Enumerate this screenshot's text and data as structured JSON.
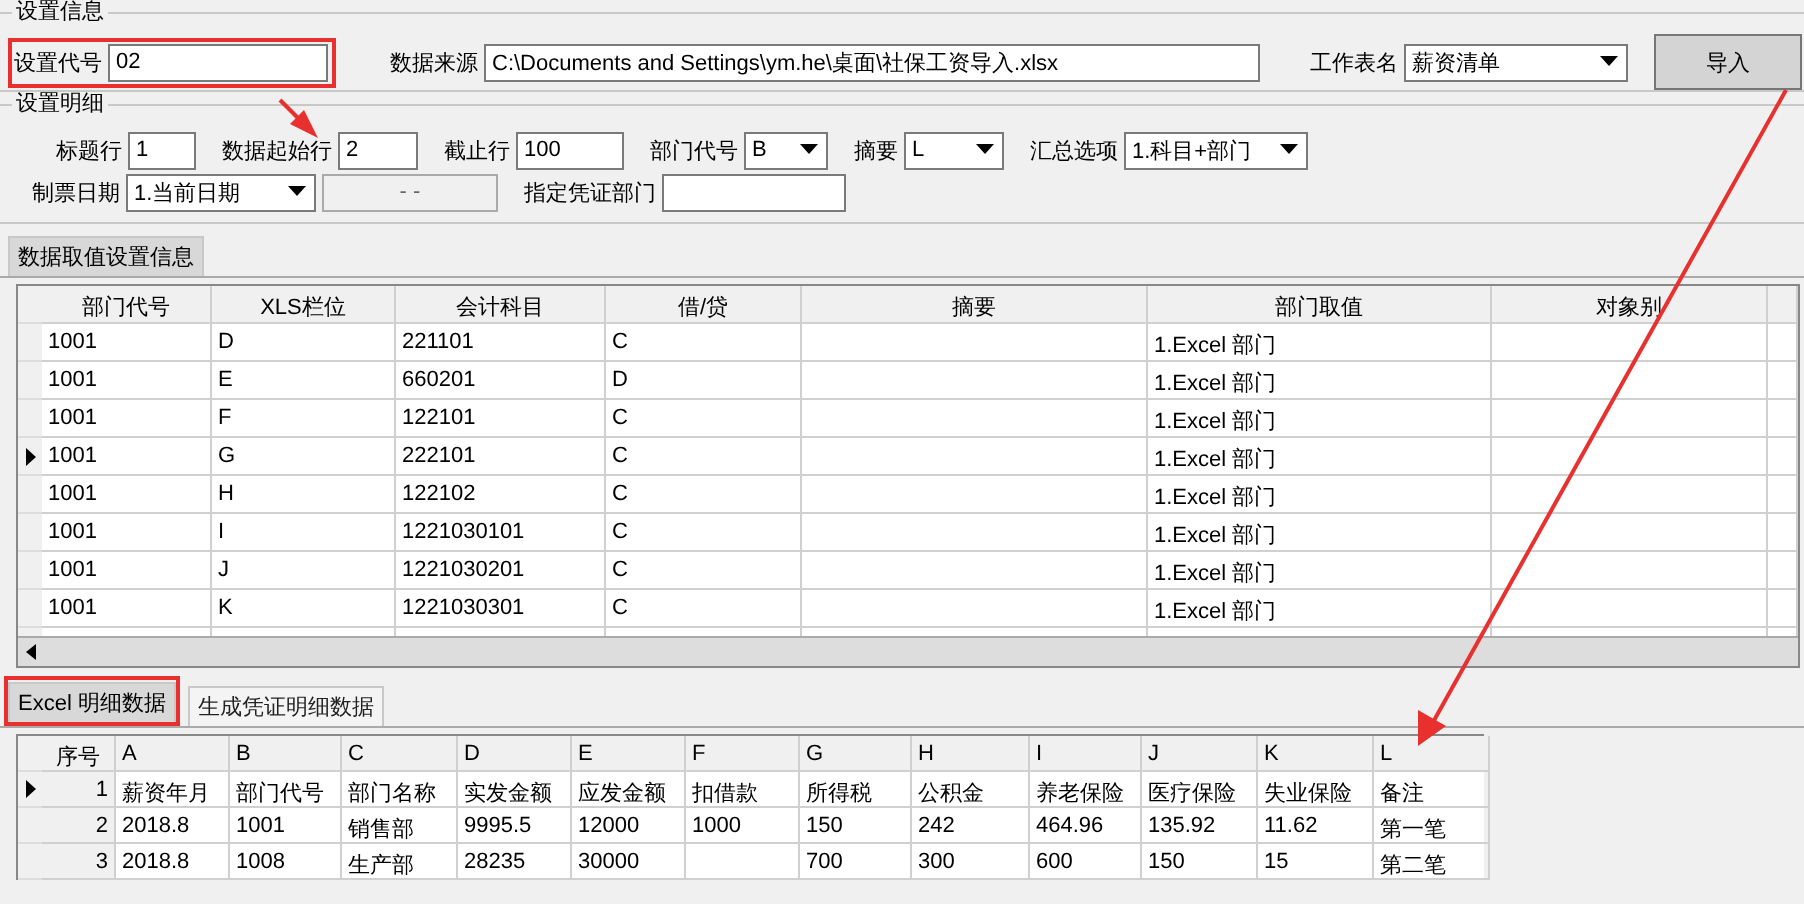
{
  "settings": {
    "title": "设置信息",
    "code_label": "设置代号",
    "code_value": "02",
    "source_label": "数据来源",
    "source_value": "C:\\Documents and Settings\\ym.he\\桌面\\社保工资导入.xlsx",
    "sheet_label": "工作表名",
    "sheet_value": "薪资清单",
    "import_button": "导入"
  },
  "detail": {
    "title": "设置明细",
    "fields": [
      {
        "kind": "input",
        "label": "标题行",
        "value": "1"
      },
      {
        "kind": "input",
        "label": "数据起始行",
        "value": "2"
      },
      {
        "kind": "input",
        "label": "截止行",
        "value": "100"
      },
      {
        "kind": "select",
        "label": "部门代号",
        "value": "B"
      },
      {
        "kind": "select",
        "label": "摘要",
        "value": "L"
      },
      {
        "kind": "select",
        "label": "汇总选项",
        "value": "1.科目+部门"
      }
    ],
    "row2": [
      {
        "kind": "select",
        "label": "制票日期",
        "value": "1.当前日期"
      },
      {
        "kind": "date",
        "placeholder": "- -"
      },
      {
        "kind": "input",
        "label": "指定凭证部门"
      }
    ]
  },
  "grid_tab": {
    "label": "数据取值设置信息",
    "selected": true
  },
  "grid": {
    "columns": [
      "部门代号",
      "XLS栏位",
      "会计科目",
      "借/贷",
      "摘要",
      "部门取值",
      "对象别"
    ],
    "rows": [
      {
        "selected": false,
        "cells": [
          "1001",
          "D",
          "221101",
          "C",
          "",
          "1.Excel 部门",
          ""
        ]
      },
      {
        "selected": false,
        "cells": [
          "1001",
          "E",
          "660201",
          "D",
          "",
          "1.Excel 部门",
          ""
        ]
      },
      {
        "selected": false,
        "cells": [
          "1001",
          "F",
          "122101",
          "C",
          "",
          "1.Excel 部门",
          ""
        ]
      },
      {
        "selected": true,
        "cells": [
          "1001",
          "G",
          "222101",
          "C",
          "",
          "1.Excel 部门",
          ""
        ]
      },
      {
        "selected": false,
        "cells": [
          "1001",
          "H",
          "122102",
          "C",
          "",
          "1.Excel 部门",
          ""
        ]
      },
      {
        "selected": false,
        "cells": [
          "1001",
          "I",
          "1221030101",
          "C",
          "",
          "1.Excel 部门",
          ""
        ]
      },
      {
        "selected": false,
        "cells": [
          "1001",
          "J",
          "1221030201",
          "C",
          "",
          "1.Excel 部门",
          ""
        ]
      },
      {
        "selected": false,
        "cells": [
          "1001",
          "K",
          "1221030301",
          "C",
          "",
          "1.Excel 部门",
          ""
        ]
      }
    ]
  },
  "bottom_tabs": [
    {
      "label": "Excel 明细数据",
      "selected": true
    },
    {
      "label": "生成凭证明细数据",
      "selected": false
    }
  ],
  "excel": {
    "columns": [
      "序号",
      "A",
      "B",
      "C",
      "D",
      "E",
      "F",
      "G",
      "H",
      "I",
      "J",
      "K",
      "L"
    ],
    "rows": [
      {
        "selected": true,
        "cells": [
          "1",
          "薪资年月",
          "部门代号",
          "部门名称",
          "实发金额",
          "应发金额",
          "扣借款",
          "所得税",
          "公积金",
          "养老保险",
          "医疗保险",
          "失业保险",
          "备注"
        ]
      },
      {
        "selected": false,
        "cells": [
          "2",
          "2018.8",
          "1001",
          "销售部",
          "9995.5",
          "12000",
          "1000",
          "150",
          "242",
          "464.96",
          "135.92",
          "11.62",
          "第一笔"
        ]
      },
      {
        "selected": false,
        "cells": [
          "3",
          "2018.8",
          "1008",
          "生产部",
          "28235",
          "30000",
          "",
          "700",
          "300",
          "600",
          "150",
          "15",
          "第二笔"
        ]
      }
    ]
  }
}
